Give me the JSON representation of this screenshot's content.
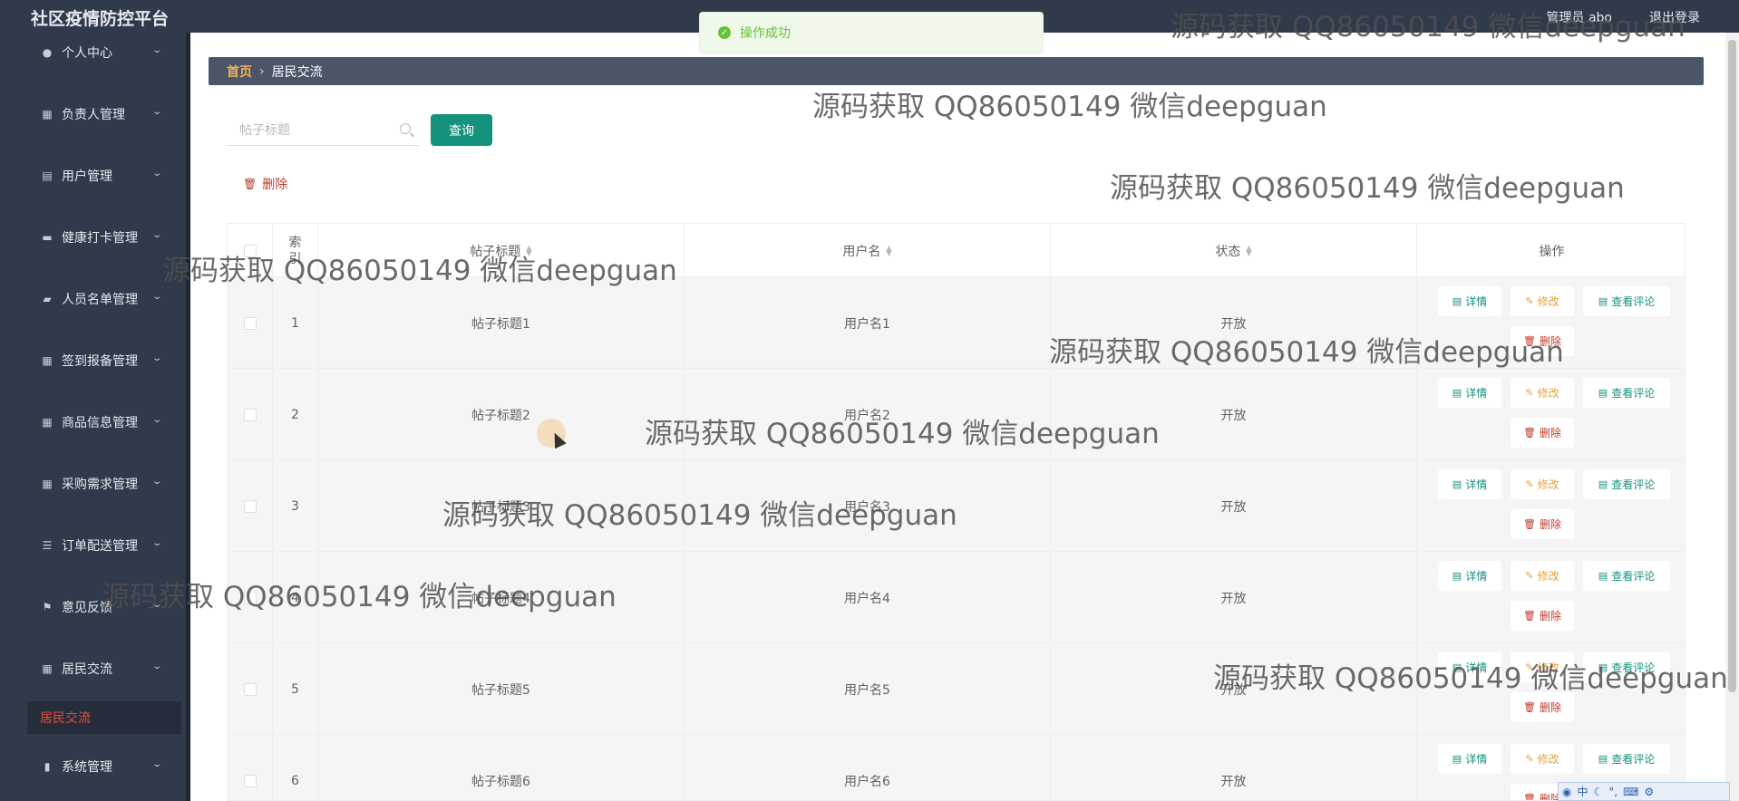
{
  "app": {
    "title": "社区疫情防控平台",
    "user_label": "管理员 abo",
    "logout_label": "退出登录"
  },
  "sidebar": {
    "items": [
      {
        "label": "个人中心",
        "icon": "person-icon"
      },
      {
        "label": "负责人管理",
        "icon": "grid-icon"
      },
      {
        "label": "用户管理",
        "icon": "doc-icon"
      },
      {
        "label": "健康打卡管理",
        "icon": "briefcase-icon"
      },
      {
        "label": "人员名单管理",
        "icon": "chat-icon"
      },
      {
        "label": "签到报备管理",
        "icon": "grid-icon"
      },
      {
        "label": "商品信息管理",
        "icon": "grid-icon"
      },
      {
        "label": "采购需求管理",
        "icon": "grid-icon"
      },
      {
        "label": "订单配送管理",
        "icon": "list-icon"
      },
      {
        "label": "意见反馈",
        "icon": "flag-icon"
      },
      {
        "label": "居民交流",
        "icon": "grid-icon"
      },
      {
        "label": "系统管理",
        "icon": "chart-icon"
      }
    ],
    "active_sub": "居民交流"
  },
  "breadcrumb": {
    "home": "首页",
    "current": "居民交流"
  },
  "search": {
    "placeholder": "帖子标题",
    "button": "查询"
  },
  "toolbar": {
    "delete_label": "删除"
  },
  "toast": {
    "message": "操作成功"
  },
  "table": {
    "columns": [
      "索引",
      "帖子标题",
      "用户名",
      "状态",
      "操作"
    ],
    "rows": [
      {
        "index": "1",
        "title": "帖子标题1",
        "user": "用户名1",
        "status": "开放"
      },
      {
        "index": "2",
        "title": "帖子标题2",
        "user": "用户名2",
        "status": "开放"
      },
      {
        "index": "3",
        "title": "帖子标题3",
        "user": "用户名3",
        "status": "开放"
      },
      {
        "index": "4",
        "title": "帖子标题4",
        "user": "用户名4",
        "status": "开放"
      },
      {
        "index": "5",
        "title": "帖子标题5",
        "user": "用户名5",
        "status": "开放"
      },
      {
        "index": "6",
        "title": "帖子标题6",
        "user": "用户名6",
        "status": "开放"
      }
    ],
    "actions": {
      "detail": "详情",
      "edit": "修改",
      "comment": "查看评论",
      "delete": "删除"
    }
  },
  "watermark": "源码获取 QQ86050149 微信deepguan",
  "ime": {
    "mode": "中"
  }
}
